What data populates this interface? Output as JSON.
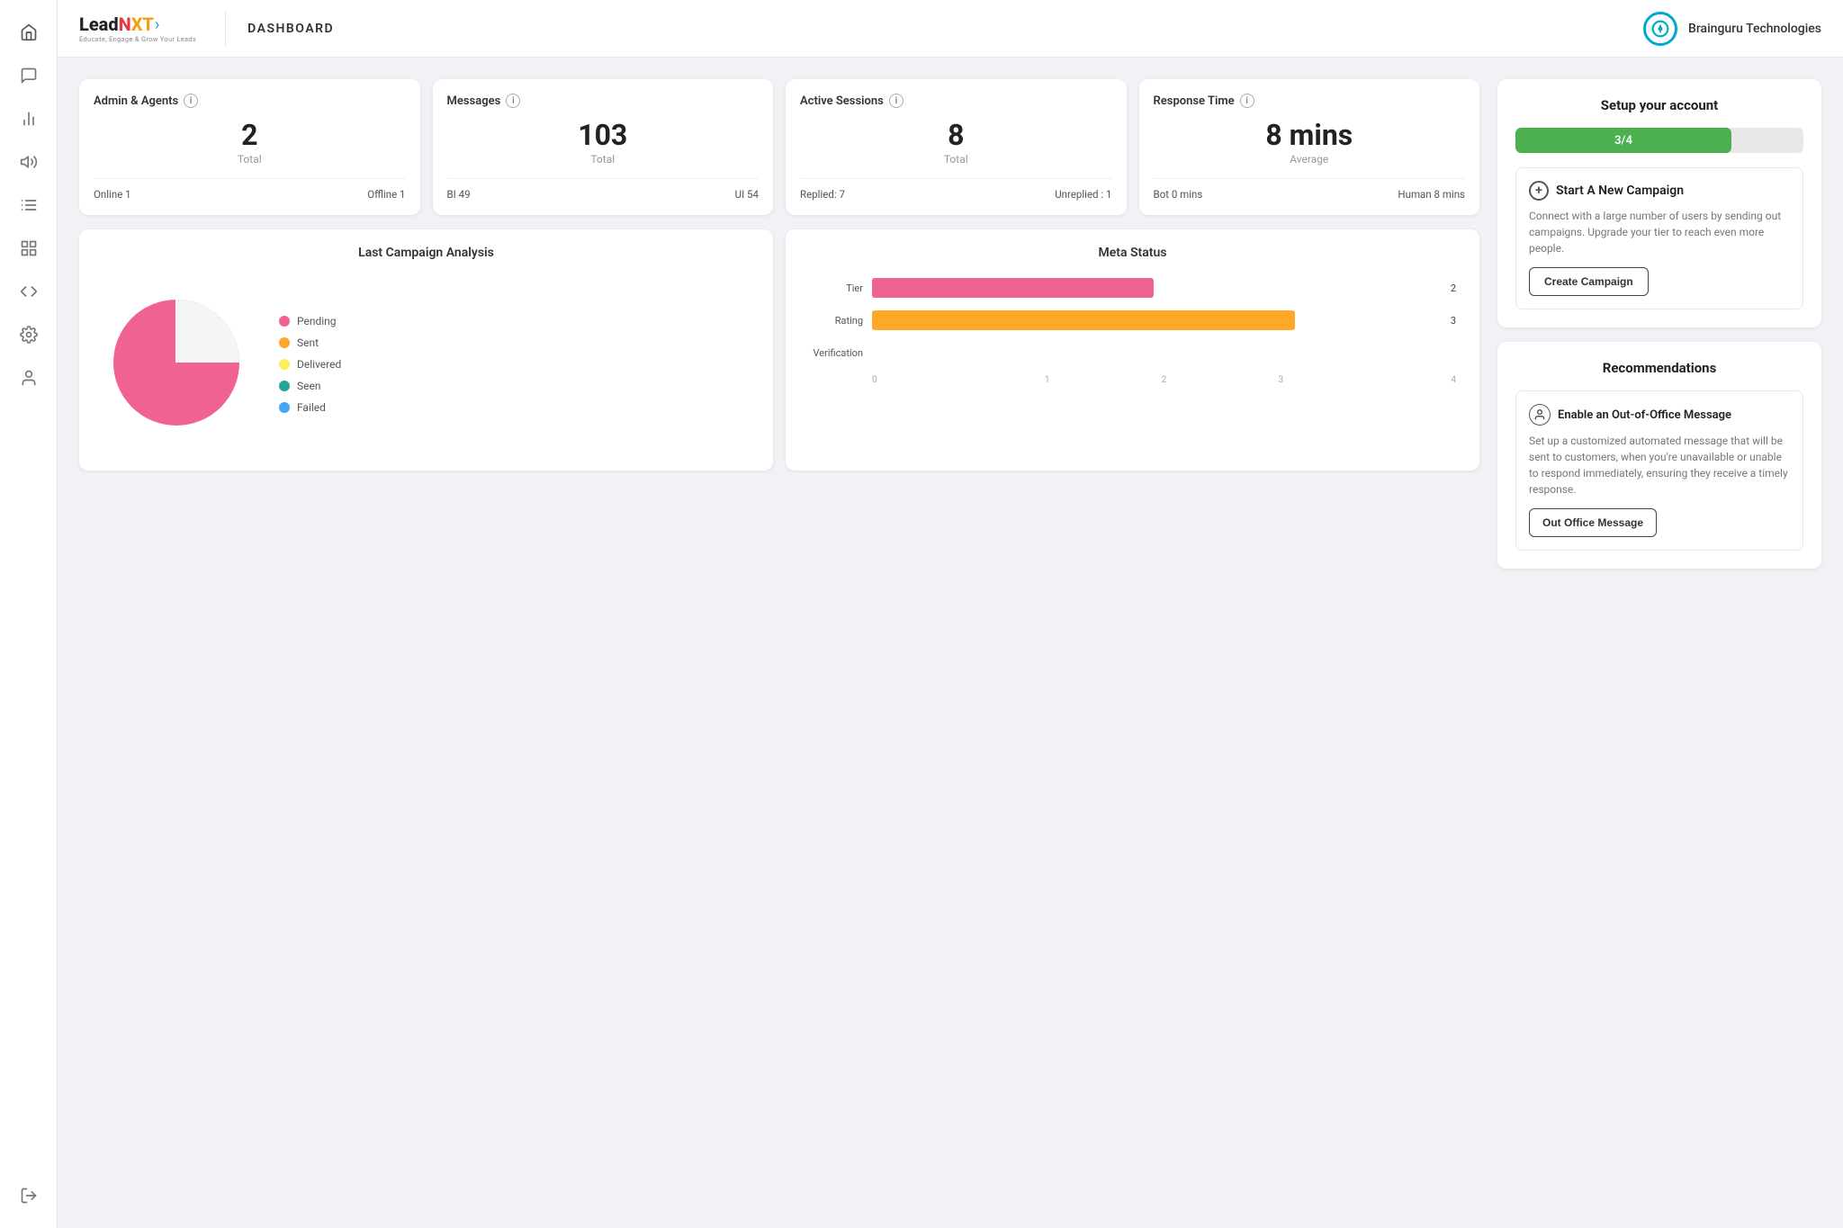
{
  "app": {
    "title": "DASHBOARD",
    "brand": "Brainguru Technologies"
  },
  "sidebar": {
    "icons": [
      {
        "name": "home-icon",
        "symbol": "⌂"
      },
      {
        "name": "chat-icon",
        "symbol": "💬"
      },
      {
        "name": "analytics-icon",
        "symbol": "📊"
      },
      {
        "name": "megaphone-icon",
        "symbol": "📢"
      },
      {
        "name": "list-icon",
        "symbol": "☰"
      },
      {
        "name": "settings-alt-icon",
        "symbol": "⚙"
      },
      {
        "name": "code-icon",
        "symbol": "</>"
      },
      {
        "name": "gear-icon",
        "symbol": "⚙"
      },
      {
        "name": "person-icon",
        "symbol": "👤"
      },
      {
        "name": "logout-icon",
        "symbol": "⎋"
      }
    ]
  },
  "stats": {
    "admin_agents": {
      "title": "Admin & Agents",
      "total_number": "2",
      "total_label": "Total",
      "footer_left": "Online 1",
      "footer_right": "Offline 1"
    },
    "messages": {
      "title": "Messages",
      "total_number": "103",
      "total_label": "Total",
      "footer_left": "BI 49",
      "footer_right": "UI 54"
    },
    "active_sessions": {
      "title": "Active Sessions",
      "total_number": "8",
      "total_label": "Total",
      "footer_left": "Replied: 7",
      "footer_right": "Unreplied : 1"
    },
    "response_time": {
      "title": "Response Time",
      "total_number": "8 mins",
      "total_label": "Average",
      "footer_left": "Bot 0 mins",
      "footer_right": "Human 8 mins"
    }
  },
  "campaign_analysis": {
    "title": "Last Campaign Analysis",
    "legend": [
      {
        "label": "Pending",
        "color": "#f06292"
      },
      {
        "label": "Sent",
        "color": "#ffa726"
      },
      {
        "label": "Delivered",
        "color": "#ffee58"
      },
      {
        "label": "Seen",
        "color": "#26a69a"
      },
      {
        "label": "Failed",
        "color": "#42a5f5"
      }
    ],
    "pie": {
      "pending_pct": 85,
      "color": "#f06292"
    }
  },
  "meta_status": {
    "title": "Meta Status",
    "bars": [
      {
        "label": "Tier",
        "value": 2,
        "max": 4,
        "color": "#f06292"
      },
      {
        "label": "Rating",
        "value": 3,
        "max": 4,
        "color": "#ffa726"
      },
      {
        "label": "Verification",
        "value": 0,
        "max": 4,
        "color": "#ccc"
      }
    ],
    "axis_labels": [
      "0",
      "1",
      "2",
      "3",
      "4"
    ]
  },
  "setup": {
    "title": "Setup your account",
    "progress_label": "3/4",
    "progress_pct": 75,
    "campaign": {
      "icon": "+",
      "title": "Start A New Campaign",
      "description": "Connect with a large number of users by sending out campaigns. Upgrade your tier to reach even more people.",
      "button_label": "Create Campaign"
    }
  },
  "recommendations": {
    "title": "Recommendations",
    "item": {
      "title": "Enable an Out-of-Office Message",
      "description": "Set up a customized automated message that will be sent to customers, when you're unavailable or unable to respond immediately, ensuring they receive a timely response.",
      "button_label": "Out Office Message"
    }
  }
}
